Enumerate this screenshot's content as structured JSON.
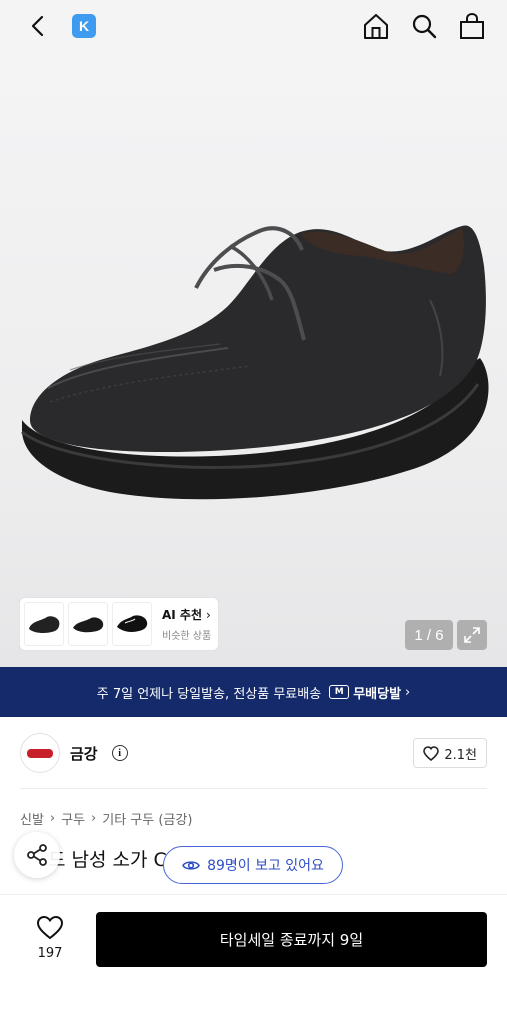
{
  "header": {
    "back_icon": "chevron-left-icon",
    "logo_text": "K",
    "icons": [
      "home-icon",
      "search-icon",
      "shopping-bag-icon"
    ]
  },
  "gallery": {
    "ai_card": {
      "title": "AI 추천",
      "chevron": "›",
      "subtitle": "비슷한 상품"
    },
    "counter": "1 / 6",
    "expand_icon": "expand-icon"
  },
  "banner": {
    "text": "주 7일 언제나 당일발송, 전상품 무료배송",
    "badge_text": "무배당발",
    "chevron": "›"
  },
  "brand": {
    "name": "금강",
    "info_glyph": "i",
    "like_count": "2.1천"
  },
  "breadcrumb": [
    "신발",
    "구두",
    "기타 구두 (금강)"
  ],
  "product": {
    "title": "드 남성 소가 COXC4466M F1"
  },
  "viewers": {
    "text": "89명이 보고 있어요"
  },
  "bottom_bar": {
    "wish_count": "197",
    "cta_label": "타임세일 종료까지 9일"
  },
  "colors": {
    "banner_bg": "#142a6b",
    "logo_blue": "#3e9bf0",
    "viewer_blue": "#2f4fc7",
    "cta_bg": "#000000"
  }
}
